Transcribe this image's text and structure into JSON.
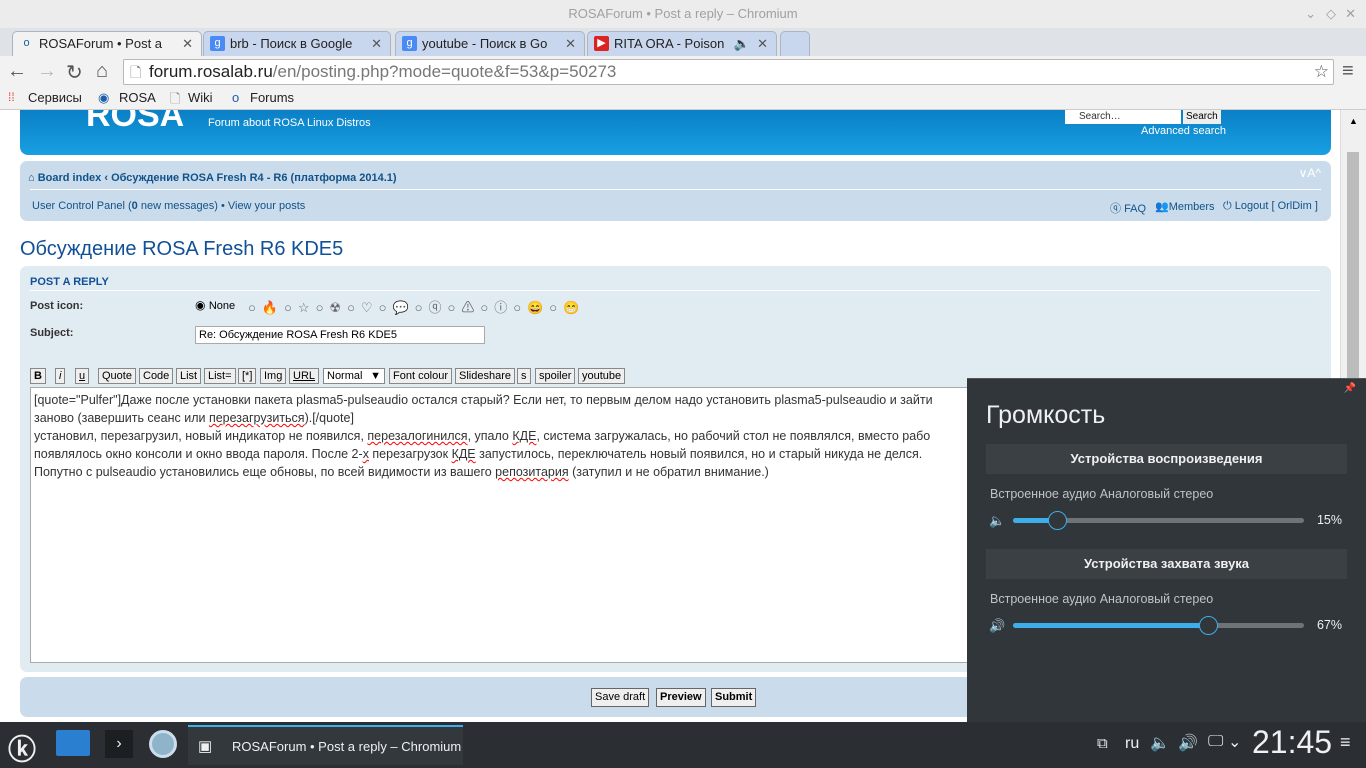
{
  "window": {
    "title": "ROSAForum • Post a reply – Chromium"
  },
  "tabs": [
    {
      "label": "ROSAForum • Post a",
      "icon": "rosa-icon"
    },
    {
      "label": "brb - Поиск в Google",
      "icon": "google-icon"
    },
    {
      "label": "youtube - Поиск в Go",
      "icon": "google-icon"
    },
    {
      "label": "RITA ORA - Poison",
      "icon": "youtube-icon"
    }
  ],
  "url": {
    "host": "forum.rosalab.ru",
    "path": "/en/posting.php?mode=quote&f=53&p=50273"
  },
  "bookmarks": [
    "Сервисы",
    "ROSA",
    "Wiki",
    "Forums"
  ],
  "header": {
    "logo": "ROSA",
    "tagline": "Forum about ROSA Linux Distros",
    "search_placeholder": "Search…",
    "search_button": "Search",
    "advanced": "Advanced search"
  },
  "nav": {
    "board_index": "Board index",
    "sep": "‹",
    "forum": "Обсуждение ROSA Fresh R4 - R6 (платформа 2014.1)",
    "font_size": "∨A^",
    "ucp": "User Control Panel",
    "msg_pre": " (",
    "msg_count": "0",
    "msg_post": " new messages) • ",
    "view_posts": "View your posts",
    "faq": "FAQ",
    "members": "Members",
    "logout": "Logout [ OrlDim ]"
  },
  "topic_title": "Обсуждение ROSA Fresh R6 KDE5",
  "post": {
    "heading": "POST A REPLY",
    "icon_label": "Post icon:",
    "none_label": "None",
    "subject_label": "Subject:",
    "subject": "Re: Обсуждение ROSA Fresh R6 KDE5"
  },
  "bbcode": [
    "B",
    "i",
    "u",
    "Quote",
    "Code",
    "List",
    "List=",
    "[*]",
    "Img",
    "URL"
  ],
  "font_size_select": "Normal",
  "bbcode2": [
    "Font colour",
    "Slideshare",
    "s",
    "spoiler",
    "youtube"
  ],
  "message": {
    "l1": "[quote=\"Pulfer\"]Даже после установки пакета plasma5-pulseaudio остался старый? Если нет, то первым делом надо установить plasma5-pulseaudio и зайти",
    "l2a": "заново (завершить сеанс или ",
    "l2b": "перезагрузиться",
    "l2c": ").[/quote]",
    "l3a": "установил, перезагрузил, новый индикатор не появился, ",
    "l3b": "перезалогинился",
    "l3c": ", упало ",
    "l3d": "КДЕ",
    "l3e": ", система загружалась, но рабочий стол не появлялся, вместо рабо",
    "l4a": "появлялось окно консоли и окно ввода пароля. После 2-",
    "l4b": "х",
    "l4c": " перезагрузок ",
    "l4d": "КДЕ",
    "l4e": " запустилось, переключатель новый появился, но и старый никуда не делся.",
    "l5a": "Попутно с pulseaudio установились еще обновы, по всей видимости из вашего ",
    "l5b": "репозитария",
    "l5c": " (затупил и не обратил внимание.)"
  },
  "buttons": {
    "save_draft": "Save draft",
    "preview": "Preview",
    "submit": "Submit"
  },
  "volume": {
    "title": "Громкость",
    "playback_heading": "Устройства воспроизведения",
    "playback_device": "Встроенное аудио Аналоговый стерео",
    "playback_pct": "15%",
    "playback_value": 15,
    "capture_heading": "Устройства захвата звука",
    "capture_device": "Встроенное аудио Аналоговый стерео",
    "capture_pct": "67%",
    "capture_value": 67,
    "accent": "#3daee9"
  },
  "taskbar": {
    "task": "ROSAForum • Post a reply – Chromium",
    "lang": "ru",
    "clock": "21:45"
  }
}
